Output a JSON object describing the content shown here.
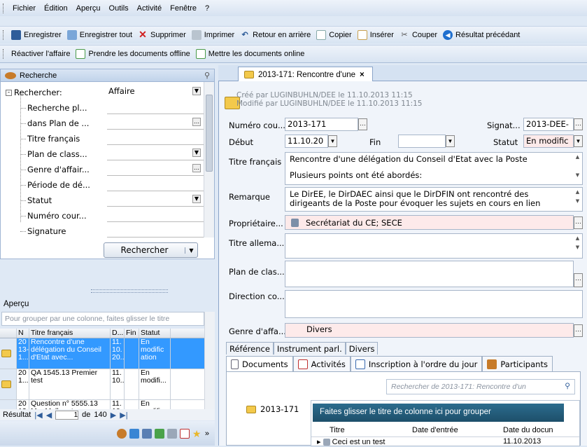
{
  "menubar": {
    "items": [
      "Fichier",
      "Édition",
      "Aperçu",
      "Outils",
      "Activité",
      "Fenêtre",
      "?"
    ]
  },
  "toolbar1": {
    "save": "Enregistrer",
    "save_all": "Enregistrer tout",
    "delete": "Supprimer",
    "print": "Imprimer",
    "back": "Retour en arrière",
    "copy": "Copier",
    "insert": "Insérer",
    "cut": "Couper",
    "prev_result": "Résultat précédant"
  },
  "toolbar2": {
    "reactivate": "Réactiver l'affaire",
    "take_offline": "Prendre les documents offline",
    "put_online": "Mettre les documents online"
  },
  "search": {
    "header": "Recherche",
    "root_label": "Rechercher:",
    "root_value": "Affaire",
    "fields": [
      "Recherche pl...",
      "dans Plan de ...",
      "Titre français",
      "Plan de class...",
      "Genre d'affair...",
      "Période de dé...",
      "Statut",
      "Numéro cour...",
      "Signature"
    ],
    "button": "Rechercher"
  },
  "apercu": {
    "title": "Aperçu",
    "group_hint": "Pour grouper par une colonne, faites glisser le titre",
    "columns": [
      "N",
      "Titre français",
      "D...",
      "Fin",
      "Statut"
    ],
    "rows": [
      {
        "n": "20 13- 1...",
        "title": "Rencontre d'une délégation du Conseil d'Etat avec...",
        "d": "11. 10. 20..",
        "fin": "",
        "status": "En modific ation"
      },
      {
        "n": "20 1...",
        "title": "QA 1545.13 Premier test",
        "d": "11. 10...",
        "fin": "",
        "status": "En modifi..."
      },
      {
        "n": "20 13",
        "title": "Question n° 5555.13 Mm Muller et",
        "d": "11. 10",
        "fin": "",
        "status": "En modific"
      }
    ],
    "pager_label": "Résultat",
    "page": "1",
    "of_label": "de",
    "total": "140"
  },
  "document": {
    "tab_title": "2013-171: Rencontre d'une",
    "created": "Créé par LUGINBUHLN/DEE le 11.10.2013 11:15",
    "modified": "Modifié par LUGINBUHLN/DEE le 11.10.2013 11:15",
    "numero_label": "Numéro cou...",
    "numero_value": "2013-171",
    "signature_label": "Signat...",
    "signature_value": "2013-DEE-",
    "debut_label": "Début",
    "debut_value": "11.10.20",
    "fin_label": "Fin",
    "fin_value": "",
    "statut_label": "Statut",
    "statut_value": "En modific",
    "titre_fr_label": "Titre français",
    "titre_fr_line1": "Rencontre d'une délégation du Conseil d'Etat avec la Poste",
    "titre_fr_line2": "Plusieurs points ont été abordés:",
    "remarque_label": "Remarque",
    "remarque_text": "Le DirEE, le DirDAEC ainsi que le DirDFIN ont rencontré des dirigeants de la Poste pour évoquer les sujets en cours en lien",
    "proprietaire_label": "Propriétaire...",
    "proprietaire_value": "Secrétariat du CE; SECE",
    "titre_de_label": "Titre allema...",
    "plan_label": "Plan de clas...",
    "direction_label": "Direction co...",
    "genre_label": "Genre d'affa...",
    "genre_value": "Divers",
    "tabs_top": [
      "Référence",
      "Instrument parl.",
      "Divers"
    ],
    "tabs_bottom": [
      "Documents",
      "Activités",
      "Inscription à l'ordre du jour",
      "Participants"
    ],
    "doc_search_placeholder": "Rechercher de 2013-171: Rencontre d'un",
    "tree_item": "2013-171",
    "drag_hint": "Faites glisser le titre de colonne ici pour grouper",
    "doc_cols": [
      "Titre",
      "Date d'entrée",
      "Date du docun"
    ],
    "doc_row": {
      "title": "Ceci est un test",
      "date_entree": "",
      "date_doc": "11.10.2013"
    }
  }
}
